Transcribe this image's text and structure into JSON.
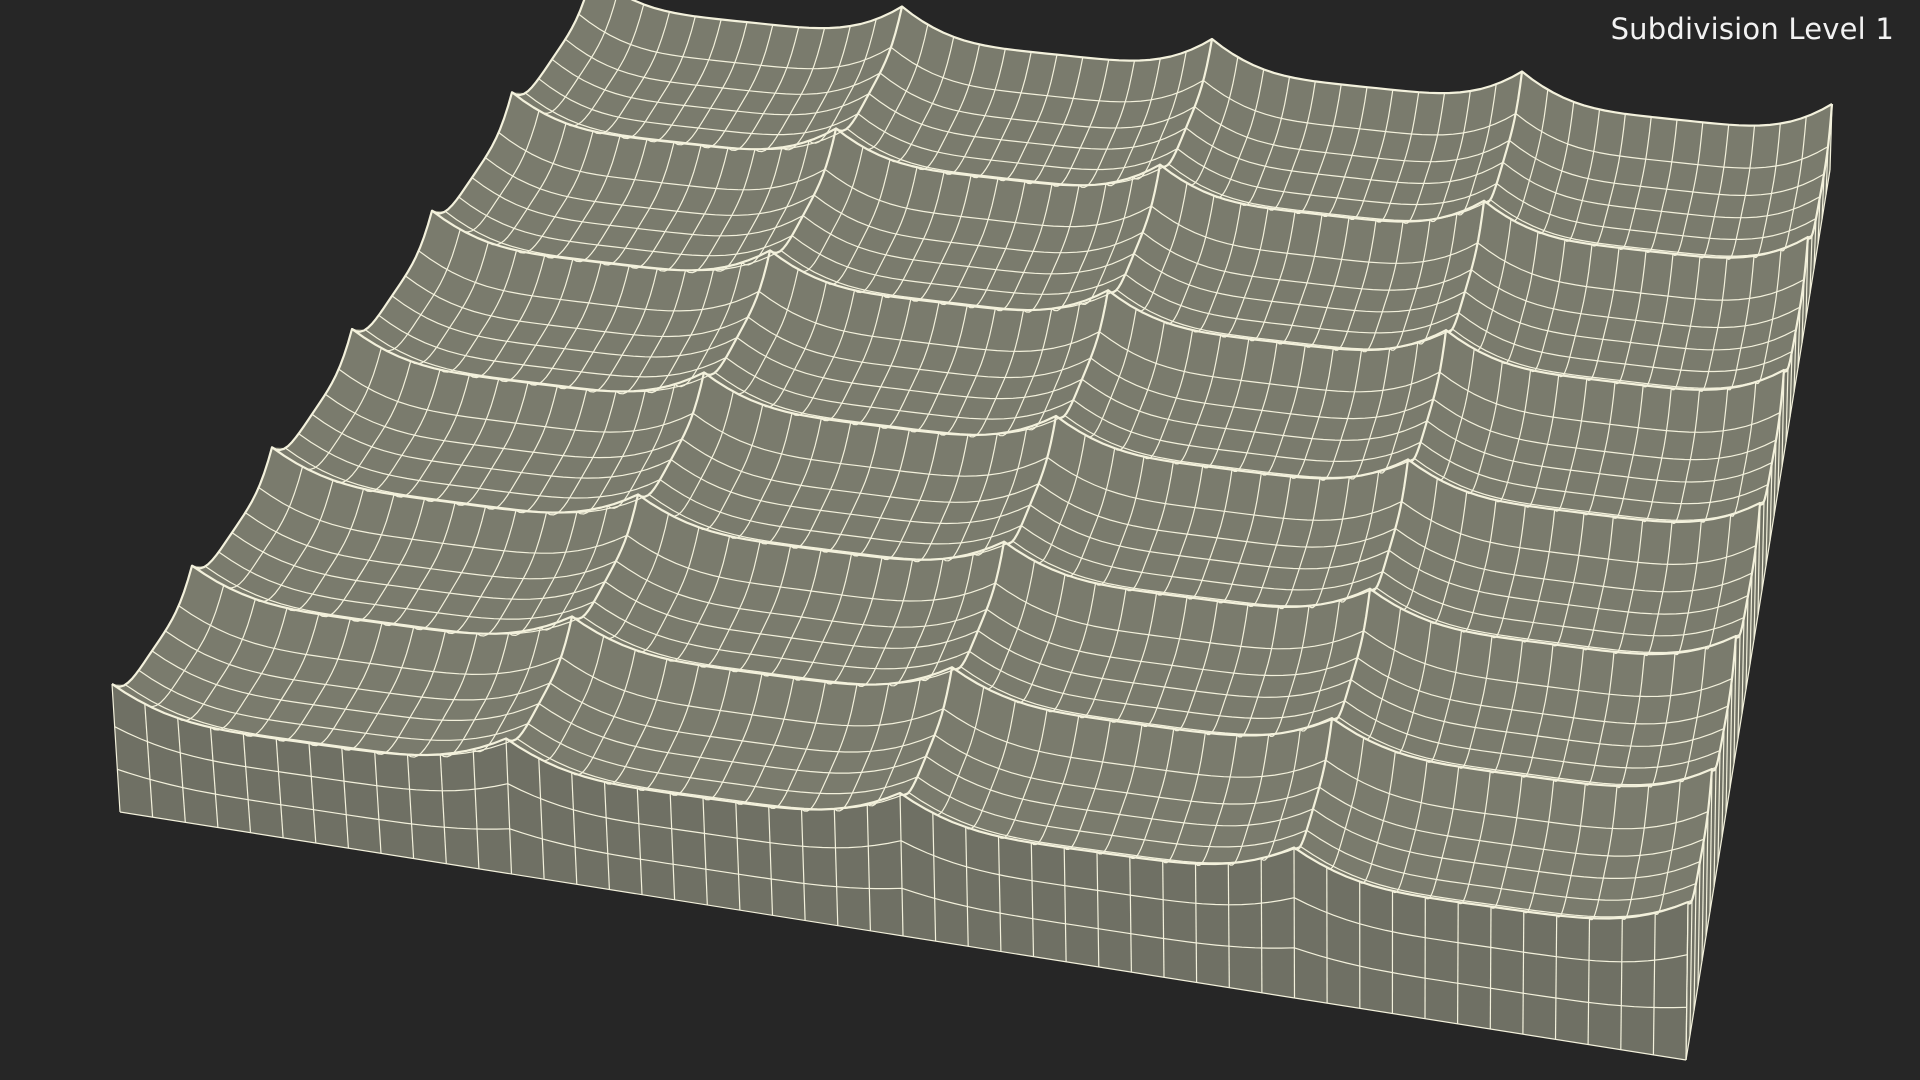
{
  "overlay": {
    "subdivision_label": "Subdivision Level 1"
  },
  "render": {
    "background_color": "#262626",
    "surface_color": "#7a7b6d",
    "side_color": "#6f7064",
    "wire_color": "#f3f1dc",
    "object": "wavy-terrain-tile-wireframe"
  }
}
